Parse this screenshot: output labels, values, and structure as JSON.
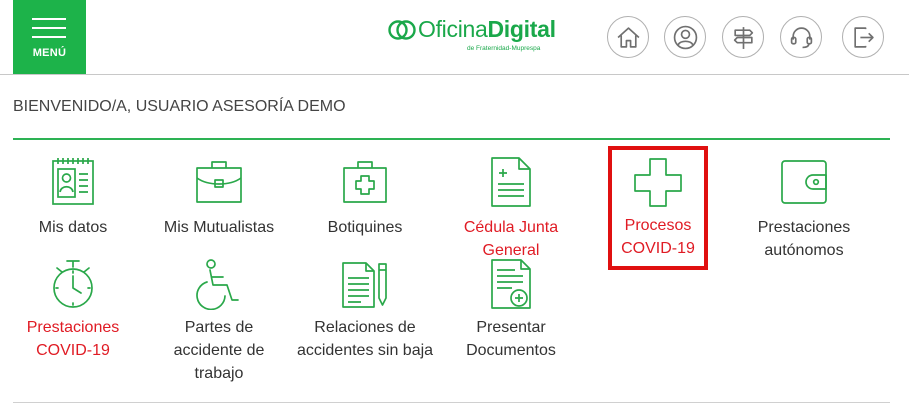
{
  "header": {
    "menu_label": "MENÚ",
    "logo_text_1": "Oficina",
    "logo_text_2": "Digital",
    "logo_tagline": "de Fraternidad-Muprespa",
    "icons": [
      "home-icon",
      "user-icon",
      "signpost-icon",
      "headset-icon",
      "logout-icon"
    ]
  },
  "welcome": "BIENVENIDO/A, USUARIO ASESORÍA DEMO",
  "colors": {
    "brand_green": "#1db34a",
    "alert_red": "#e01b24",
    "highlight_red": "#e01010"
  },
  "tiles": {
    "mis_datos": {
      "label": "Mis datos",
      "icon": "id-card-icon"
    },
    "mis_mutualistas": {
      "label": "Mis Mutualistas",
      "icon": "briefcase-icon"
    },
    "botiquines": {
      "label": "Botiquines",
      "icon": "first-aid-kit-icon"
    },
    "cedula": {
      "label": "Cédula Junta General",
      "icon": "document-plus-icon"
    },
    "procesos_covid": {
      "label": "Procesos COVID-19",
      "icon": "cross-icon"
    },
    "prestaciones_autonomos": {
      "label": "Prestaciones autónomos",
      "icon": "wallet-icon"
    },
    "prestaciones_covid": {
      "label": "Prestaciones COVID-19",
      "icon": "stopwatch-icon"
    },
    "partes_accidente": {
      "label": "Partes de accidente de trabajo",
      "icon": "wheelchair-icon"
    },
    "relaciones_accidentes": {
      "label": "Relaciones de accidentes sin baja",
      "icon": "document-pencil-icon"
    },
    "presentar_documentos": {
      "label": "Presentar Documentos",
      "icon": "document-upload-icon"
    }
  }
}
